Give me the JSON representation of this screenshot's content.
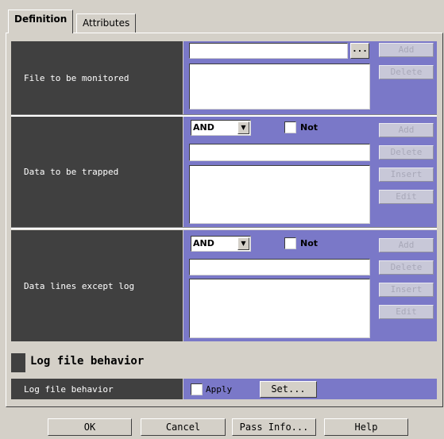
{
  "tabs": [
    {
      "label": "Definition",
      "active": true
    },
    {
      "label": "Attributes",
      "active": false
    }
  ],
  "file_monitored": {
    "label": "File to be monitored",
    "input_value": "",
    "browse_label": "...",
    "add_label": "Add",
    "delete_label": "Delete"
  },
  "data_trapped": {
    "label": "Data to be trapped",
    "operator": "AND",
    "not_label": "Not",
    "input_value": "",
    "add_label": "Add",
    "delete_label": "Delete",
    "insert_label": "Insert",
    "edit_label": "Edit"
  },
  "data_except": {
    "label": "Data lines except log",
    "operator": "AND",
    "not_label": "Not",
    "input_value": "",
    "add_label": "Add",
    "delete_label": "Delete",
    "insert_label": "Insert",
    "edit_label": "Edit"
  },
  "log_behavior": {
    "section_title": "Log file behavior",
    "row_label": "Log file behavior",
    "apply_label": "Apply",
    "set_label": "Set..."
  },
  "footer": {
    "ok_label": "OK",
    "cancel_label": "Cancel",
    "pass_info_label": "Pass Info...",
    "help_label": "Help"
  },
  "colors": {
    "label_bg": "#404040",
    "control_bg": "#7a78c8",
    "window_bg": "#d4d0c8"
  }
}
